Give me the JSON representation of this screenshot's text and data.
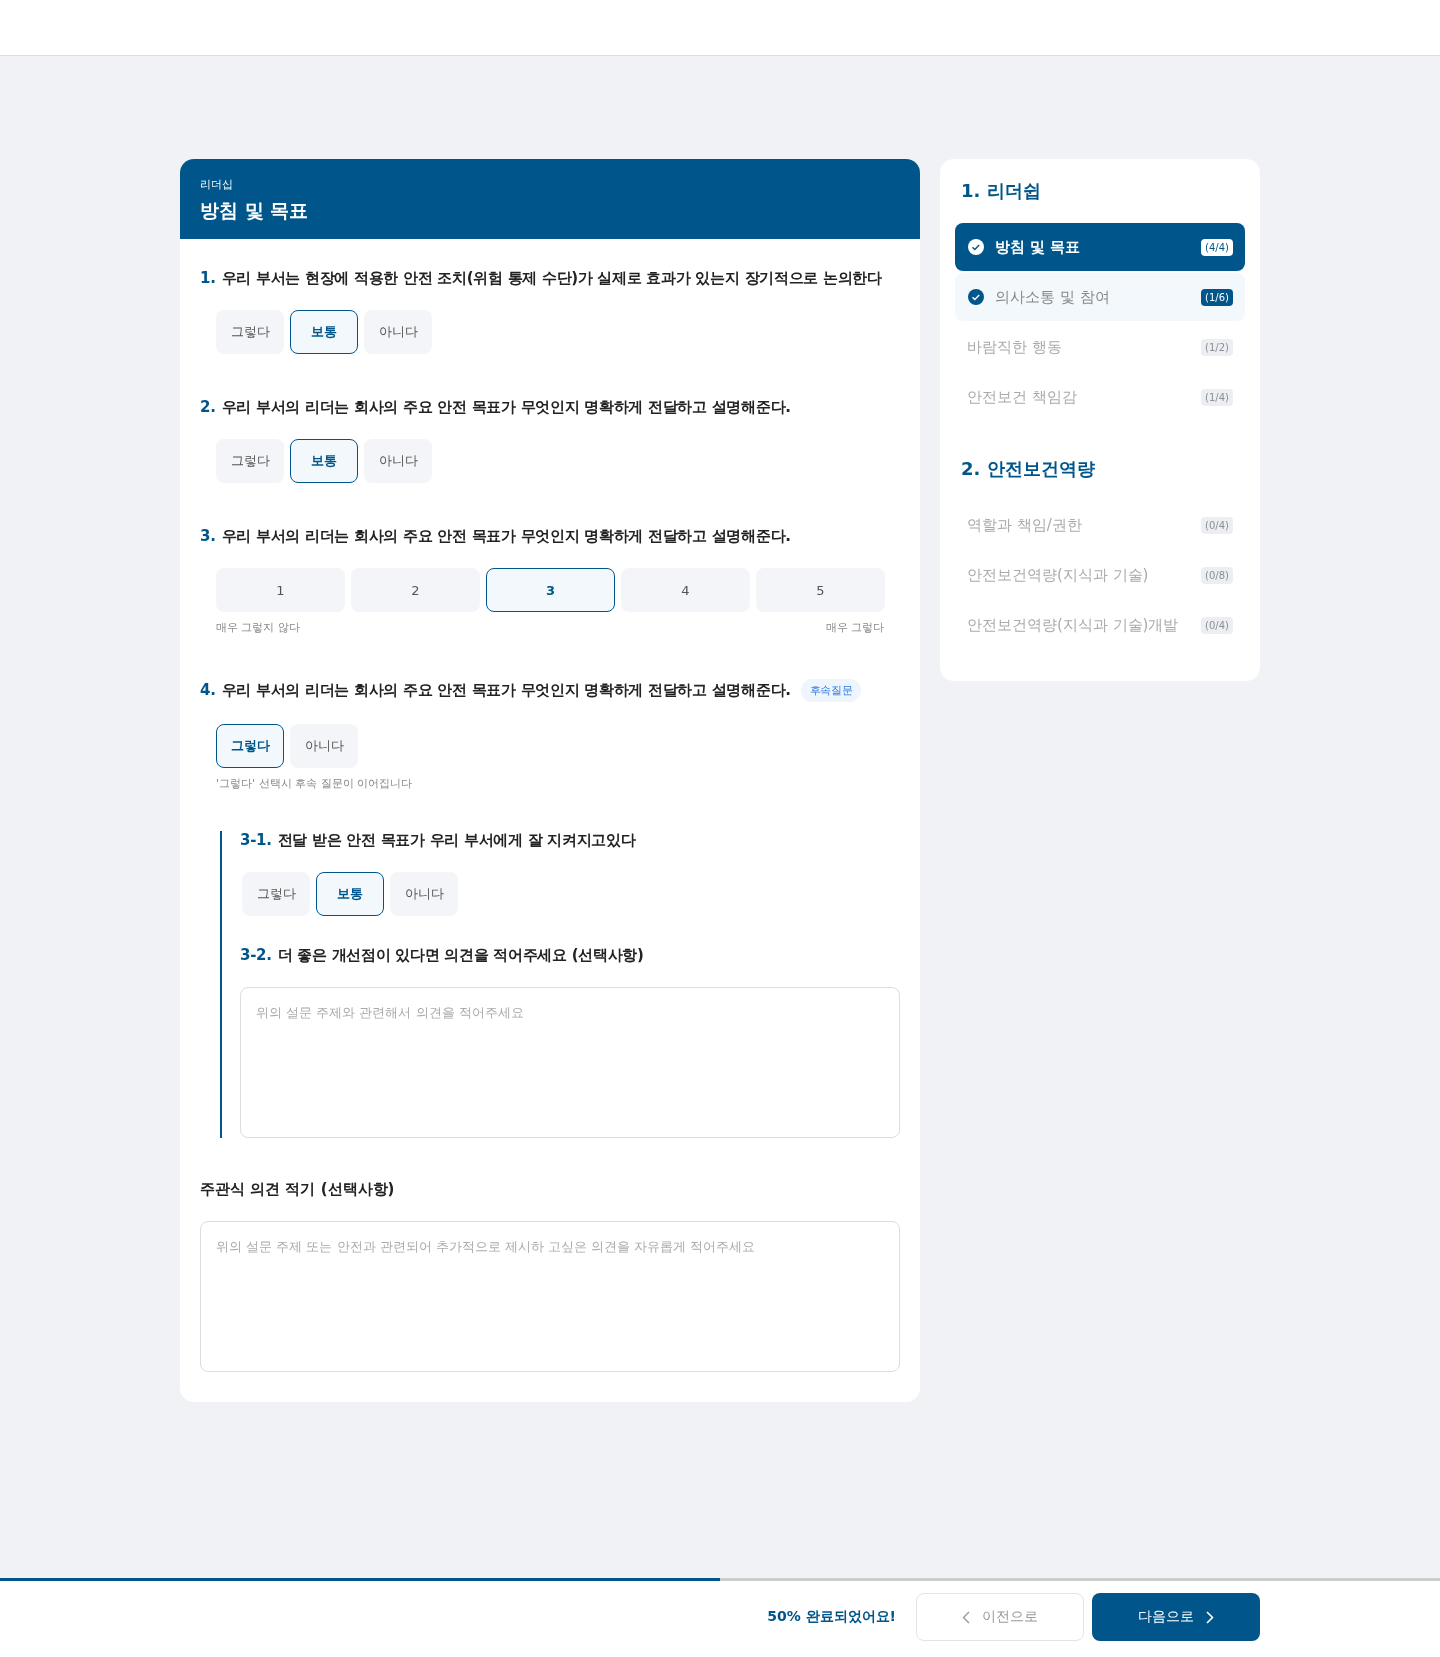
{
  "header": {
    "category": "리더십",
    "title": "방침 및 목표"
  },
  "questions": [
    {
      "kind": "choice",
      "number": "1.",
      "text": "우리 부서는 현장에 적용한 안전 조치(위험 통제 수단)가 실제로 효과가 있는지 장기적으로 논의한다",
      "options": [
        {
          "label": "그렇다",
          "selected": false
        },
        {
          "label": "보통",
          "selected": true
        },
        {
          "label": "아니다",
          "selected": false
        }
      ]
    },
    {
      "kind": "choice",
      "number": "2.",
      "text": "우리 부서의 리더는 회사의 주요 안전 목표가 무엇인지 명확하게 전달하고 설명해준다.",
      "options": [
        {
          "label": "그렇다",
          "selected": false
        },
        {
          "label": "보통",
          "selected": true
        },
        {
          "label": "아니다",
          "selected": false
        }
      ]
    },
    {
      "kind": "scale",
      "number": "3.",
      "text": "우리 부서의 리더는 회사의 주요 안전 목표가 무엇인지 명확하게 전달하고 설명해준다.",
      "options": [
        {
          "label": "1",
          "selected": false
        },
        {
          "label": "2",
          "selected": false
        },
        {
          "label": "3",
          "selected": true
        },
        {
          "label": "4",
          "selected": false
        },
        {
          "label": "5",
          "selected": false
        }
      ],
      "low_label": "매우 그렇지 않다",
      "high_label": "매우 그렇다"
    },
    {
      "kind": "choice",
      "number": "4.",
      "text": "우리 부서의 리더는 회사의 주요 안전 목표가 무엇인지 명확하게 전달하고 설명해준다.",
      "tag": "후속질문",
      "options": [
        {
          "label": "그렇다",
          "selected": true
        },
        {
          "label": "아니다",
          "selected": false
        }
      ],
      "hint": "'그렇다' 선택시 후속 질문이 이어집니다",
      "followups": [
        {
          "kind": "choice",
          "number": "3-1.",
          "text": "전달 받은 안전 목표가 우리 부서에게 잘 지켜지고있다",
          "options": [
            {
              "label": "그렇다",
              "selected": false
            },
            {
              "label": "보통",
              "selected": true
            },
            {
              "label": "아니다",
              "selected": false
            }
          ]
        },
        {
          "kind": "text",
          "number": "3-2.",
          "text": "더 좋은 개선점이 있다면 의견을 적어주세요 (선택사항)",
          "placeholder": "위의 설문 주제와 관련해서 의견을 적어주세요"
        }
      ]
    }
  ],
  "comment": {
    "label": "주관식 의견 적기 (선택사항)",
    "placeholder": "위의 설문 주제 또는 안전과 관련되어 추가적으로 제시하 고싶은 의견을 자유롭게 적어주세요"
  },
  "sidebar": {
    "sections": [
      {
        "title": "1. 리더쉽",
        "items": [
          {
            "label": "방침 및 목표",
            "count": "(4/4)",
            "done": true,
            "selected": true
          },
          {
            "label": "의사소통 및 참여",
            "count": "(1/6)",
            "done": true,
            "selected": false
          },
          {
            "label": "바람직한 행동",
            "count": "(1/2)",
            "done": false,
            "selected": false
          },
          {
            "label": "안전보건 책임감",
            "count": "(1/4)",
            "done": false,
            "selected": false
          }
        ]
      },
      {
        "title": "2. 안전보건역량",
        "items": [
          {
            "label": "역할과 책임/권한",
            "count": "(0/4)",
            "done": false,
            "selected": false
          },
          {
            "label": "안전보건역량(지식과 기술)",
            "count": "(0/8)",
            "done": false,
            "selected": false
          },
          {
            "label": "안전보건역량(지식과 기술)개발",
            "count": "(0/4)",
            "done": false,
            "selected": false
          }
        ]
      }
    ]
  },
  "footer": {
    "progress": {
      "level": 0.5
    },
    "status": "50% 완료되었어요!",
    "prev": {
      "label": "이전으로",
      "disabled": true
    },
    "next": {
      "label": "다음으로",
      "disabled": false
    }
  }
}
